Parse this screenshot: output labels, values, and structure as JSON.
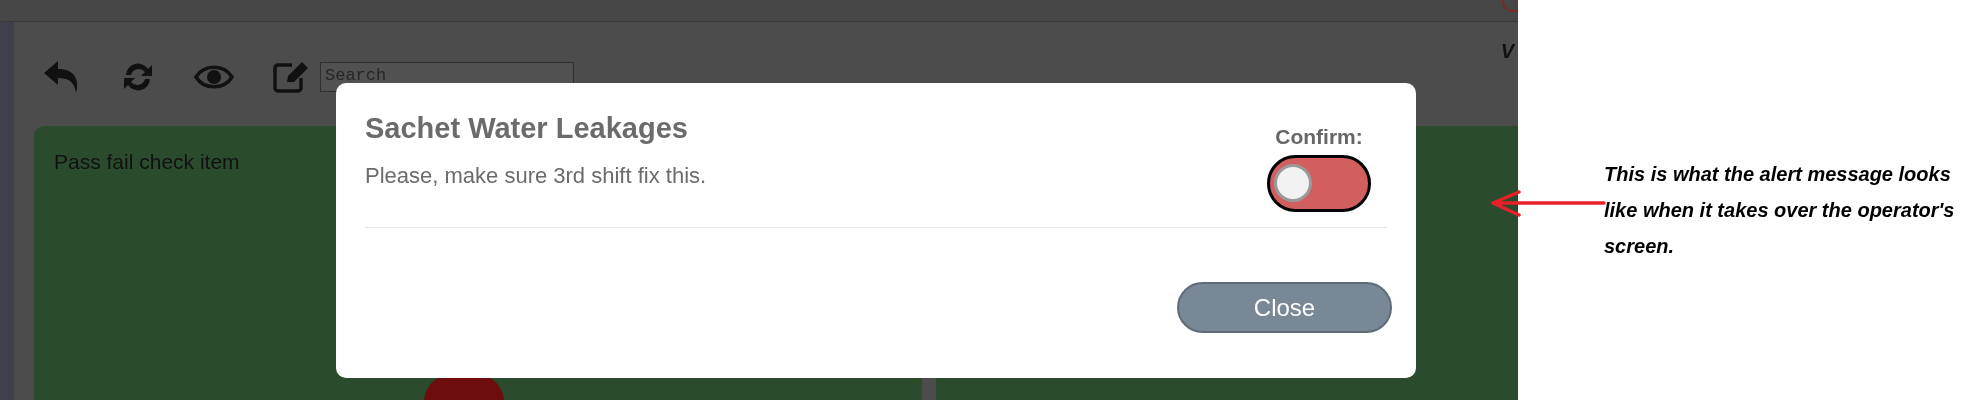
{
  "header": {
    "cut_text": "V"
  },
  "search": {
    "placeholder": "Search"
  },
  "panel": {
    "title": "Pass fail check item"
  },
  "modal": {
    "title": "Sachet Water Leakages",
    "message": "Please, make sure 3rd shift fix this.",
    "confirm_label": "Confirm:",
    "confirm_toggle": {
      "on": false
    },
    "close_button": "Close"
  },
  "annotation": {
    "text": "This is what the alert message looks like when it takes over the operator's screen."
  }
}
